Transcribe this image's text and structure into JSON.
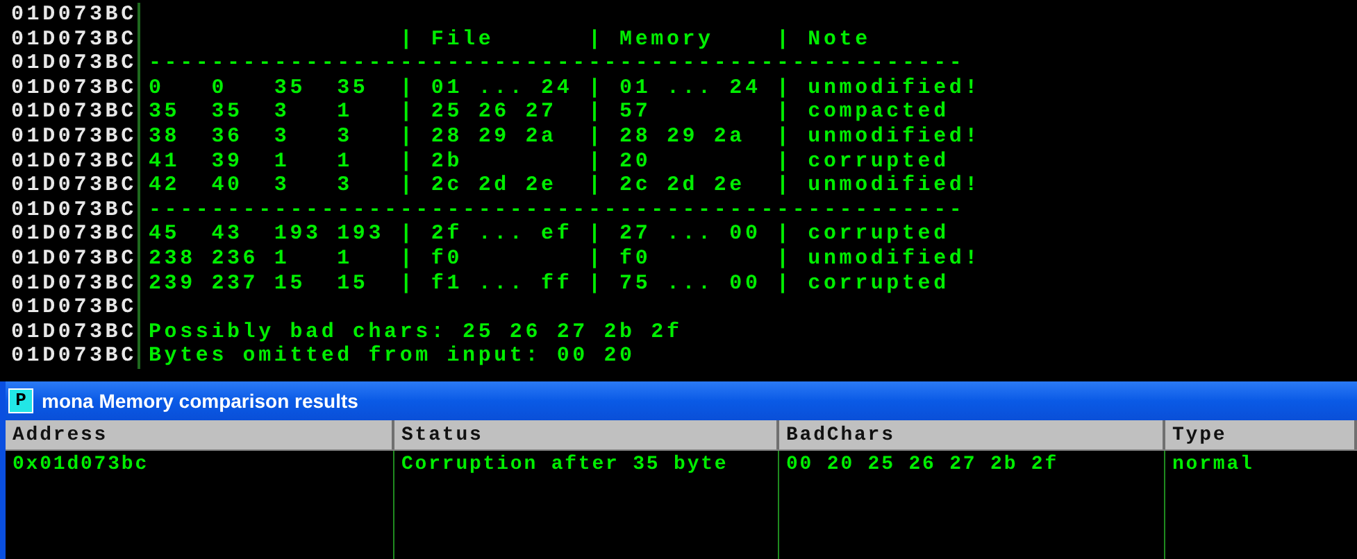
{
  "log": {
    "lines": [
      {
        "address": "01D073BC"
      },
      {
        "address": "01D073BC",
        "message": "                | File      | Memory    | Note"
      },
      {
        "address": "01D073BC",
        "message": "----------------------------------------------------"
      },
      {
        "address": "01D073BC",
        "message": "0   0   35  35  | 01 ... 24 | 01 ... 24 | unmodified!"
      },
      {
        "address": "01D073BC",
        "message": "35  35  3   1   | 25 26 27  | 57        | compacted"
      },
      {
        "address": "01D073BC",
        "message": "38  36  3   3   | 28 29 2a  | 28 29 2a  | unmodified!"
      },
      {
        "address": "01D073BC",
        "message": "41  39  1   1   | 2b        | 20        | corrupted"
      },
      {
        "address": "01D073BC",
        "message": "42  40  3   3   | 2c 2d 2e  | 2c 2d 2e  | unmodified!"
      },
      {
        "address": "01D073BC",
        "message": "----------------------------------------------------"
      },
      {
        "address": "01D073BC",
        "message": "45  43  193 193 | 2f ... ef | 27 ... 00 | corrupted"
      },
      {
        "address": "01D073BC",
        "message": "238 236 1   1   | f0        | f0        | unmodified!"
      },
      {
        "address": "01D073BC",
        "message": "239 237 15  15  | f1 ... ff | 75 ... 00 | corrupted"
      },
      {
        "address": "01D073BC"
      },
      {
        "address": "01D073BC",
        "message": "Possibly bad chars: 25 26 27 2b 2f"
      },
      {
        "address": "01D073BC",
        "message": "Bytes omitted from input: 00 20"
      }
    ]
  },
  "dialog": {
    "icon_letter": "P",
    "title": "mona Memory comparison results",
    "columns": [
      "Address",
      "Status",
      "BadChars",
      "Type"
    ],
    "rows": [
      {
        "cells": [
          "0x01d073bc",
          "Corruption after 35 byte",
          "00 20 25 26 27 2b 2f",
          "normal"
        ]
      }
    ]
  }
}
